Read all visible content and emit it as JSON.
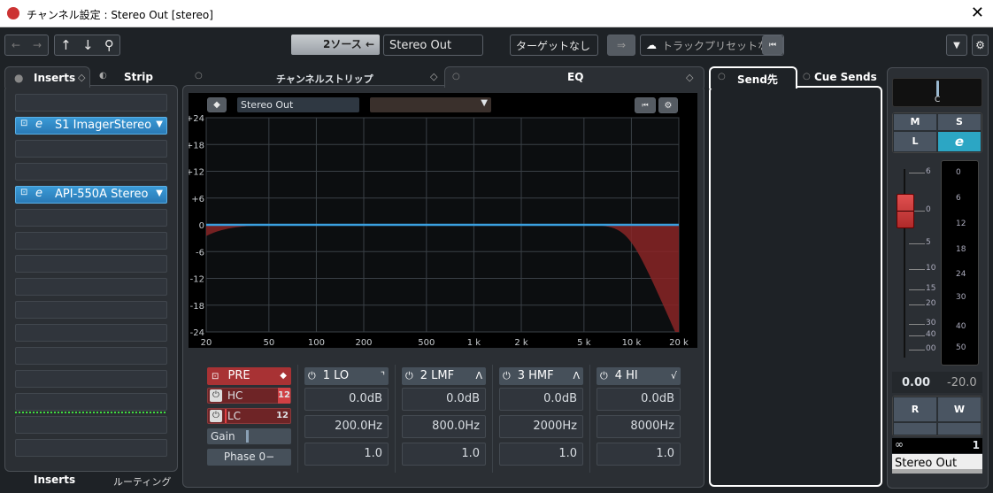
{
  "window": {
    "title": "チャンネル設定 : Stereo Out [stereo]",
    "close": "✕"
  },
  "toolbar": {
    "back": "←",
    "forward": "→",
    "up": "↑",
    "down": "↓",
    "search": "⚲",
    "source": "2ソース ←",
    "channel_name": "Stereo Out",
    "target": "ターゲットなし",
    "preset": "トラックプリセットな.",
    "preset_reset": "⏮",
    "menu": "▼",
    "settings": "⚙"
  },
  "left_tabs": {
    "inserts": "Inserts",
    "strip": "Strip"
  },
  "inserts": {
    "slots": [
      "",
      "S1 ImagerStereo",
      "",
      "",
      "API-550A Stereo",
      "",
      "",
      "",
      "",
      "",
      "",
      "",
      "",
      "",
      "",
      ""
    ]
  },
  "bottom_tabs": {
    "inserts": "Inserts",
    "routing": "ルーティング"
  },
  "center_tabs": {
    "strip": "チャンネルストリップ",
    "eq": "EQ"
  },
  "eq": {
    "channel": "Stereo Out",
    "preset": "",
    "pre": {
      "label": "PRE",
      "hc": "HC",
      "hc_slope": "12",
      "lc": "LC",
      "lc_slope": "12",
      "gain": "Gain",
      "phase": "Phase 0−"
    },
    "bands": [
      {
        "name": "1 LO",
        "shape": "⌝",
        "gain": "0.0dB",
        "freq": "200.0Hz",
        "q": "1.0"
      },
      {
        "name": "2 LMF",
        "shape": "ᐱ",
        "gain": "0.0dB",
        "freq": "800.0Hz",
        "q": "1.0"
      },
      {
        "name": "3 HMF",
        "shape": "ᐱ",
        "gain": "0.0dB",
        "freq": "2000Hz",
        "q": "1.0"
      },
      {
        "name": "4 HI",
        "shape": "√",
        "gain": "0.0dB",
        "freq": "8000Hz",
        "q": "1.0"
      }
    ]
  },
  "chart_data": {
    "type": "line",
    "x_scale": "log",
    "xlim": [
      20,
      20000
    ],
    "ylim": [
      -24,
      24
    ],
    "grid": true,
    "x_ticks": [
      20,
      50,
      100,
      200,
      500,
      1000,
      2000,
      5000,
      10000,
      20000
    ],
    "x_tick_labels": [
      "20",
      "50",
      "100",
      "200",
      "500",
      "1 k",
      "2 k",
      "5 k",
      "10 k",
      "20 k"
    ],
    "y_ticks": [
      24,
      18,
      12,
      6,
      0,
      -6,
      -12,
      -18,
      -24
    ],
    "y_tick_labels": [
      "+24",
      "+18",
      "+12",
      "+6",
      "0",
      "-6",
      "-12",
      "-18",
      "-24"
    ],
    "series": [
      {
        "values_db": 0,
        "color": "#3aa0e0"
      }
    ],
    "filter_regions": [
      {
        "type": "low-cut",
        "color": "#8a2426"
      },
      {
        "type": "high-cut",
        "color": "#8a2426"
      }
    ]
  },
  "sends_tabs": {
    "send": "Send先",
    "cue": "Cue Sends"
  },
  "fader": {
    "pan": "C",
    "mute": "M",
    "solo": "S",
    "listen": "L",
    "edit": "e",
    "scale": [
      "6",
      "0",
      "5",
      "10",
      "15",
      "20",
      "30",
      "40",
      "00"
    ],
    "meter_scale": [
      "0",
      "6",
      "12",
      "18",
      "24",
      "30",
      "40",
      "50"
    ],
    "volume": "0.00",
    "peak": "-20.0",
    "read": "R",
    "write": "W",
    "channels": "1",
    "name": "Stereo Out",
    "fader_db": 0
  }
}
